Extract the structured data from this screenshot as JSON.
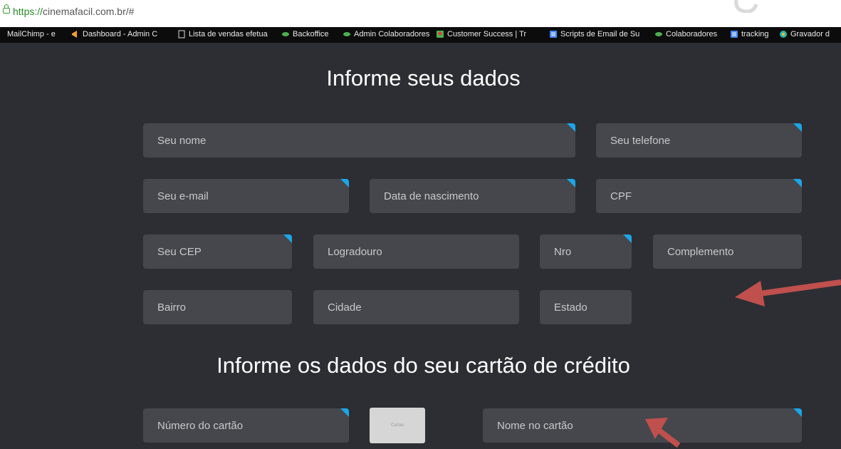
{
  "browser": {
    "url_prefix": "https://",
    "url_rest": "cinemafacil.com.br/#",
    "bookmarks": [
      {
        "label": "MailChimp - e",
        "icon": "none"
      },
      {
        "label": "Dashboard - Admin C",
        "icon": "megaphone-icon"
      },
      {
        "label": "Lista de vendas efetua",
        "icon": "page-icon"
      },
      {
        "label": "Backoffice",
        "icon": "green-leaf-icon"
      },
      {
        "label": "Admin Colaboradores",
        "icon": "green-leaf-icon"
      },
      {
        "label": "Customer Success | Tr",
        "icon": "map-pin-icon"
      },
      {
        "label": "Scripts de Email de Su",
        "icon": "doc-icon"
      },
      {
        "label": "Colaboradores",
        "icon": "green-leaf-icon"
      },
      {
        "label": "tracking",
        "icon": "doc-icon"
      },
      {
        "label": "Gravador d",
        "icon": "recorder-icon"
      }
    ]
  },
  "form": {
    "personal_heading": "Informe seus dados",
    "card_heading": "Informe os dados do seu cartão de crédito",
    "fields": {
      "nome": "Seu nome",
      "telefone": "Seu telefone",
      "email": "Seu e-mail",
      "nascimento": "Data de nascimento",
      "cpf": "CPF",
      "cep": "Seu CEP",
      "logradouro": "Logradouro",
      "nro": "Nro",
      "complemento": "Complemento",
      "bairro": "Bairro",
      "cidade": "Cidade",
      "estado": "Estado",
      "numero_cartao": "Número do cartão",
      "nome_cartao": "Nome no cartão"
    },
    "card_image_label": "Cartao"
  },
  "colors": {
    "background": "#2d2e33",
    "field": "#45474c",
    "required_marker": "#1ca6e6",
    "annotation_arrow": "#c0504d"
  }
}
